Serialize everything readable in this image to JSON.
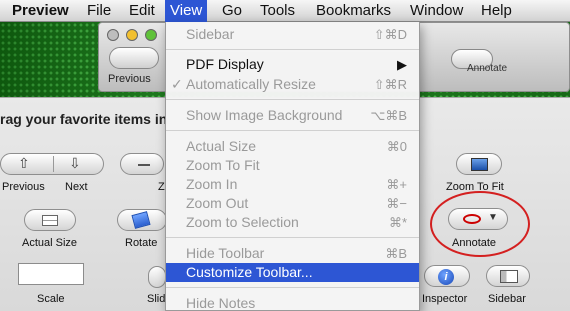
{
  "menubar": {
    "apple_menu": "Preview",
    "items": [
      "File",
      "Edit",
      "View",
      "Go",
      "Tools",
      "Bookmarks",
      "Window",
      "Help"
    ]
  },
  "background_window": {
    "previous_label": "Previous",
    "annotate_label": "Annotate"
  },
  "view_menu": {
    "items": [
      {
        "label": "Sidebar",
        "shortcut": "⇧⌘D",
        "enabled": false
      },
      {
        "label": "PDF Display",
        "shortcut": "▶",
        "enabled": true
      },
      {
        "label": "Automatically Resize",
        "shortcut": "⇧⌘R",
        "enabled": false,
        "checked": true,
        "check": "✓"
      },
      {
        "label": "Show Image Background",
        "shortcut": "⌥⌘B",
        "enabled": false
      },
      {
        "label": "Actual Size",
        "shortcut": "⌘0",
        "enabled": false
      },
      {
        "label": "Zoom To Fit",
        "shortcut": "",
        "enabled": false
      },
      {
        "label": "Zoom In",
        "shortcut": "⌘+",
        "enabled": false
      },
      {
        "label": "Zoom Out",
        "shortcut": "⌘−",
        "enabled": false
      },
      {
        "label": "Zoom to Selection",
        "shortcut": "⌘*",
        "enabled": false
      },
      {
        "label": "Hide Toolbar",
        "shortcut": "⌘B",
        "enabled": false
      },
      {
        "label": "Customize Toolbar...",
        "shortcut": "",
        "enabled": true,
        "highlighted": true
      },
      {
        "label": "Hide Notes",
        "shortcut": "",
        "enabled": false
      }
    ]
  },
  "customize_sheet": {
    "heading": "rag your favorite items in",
    "items": {
      "previous": "Previous",
      "next": "Next",
      "zoom": "Z",
      "zoom_to_fit": "Zoom To Fit",
      "actual_size": "Actual Size",
      "rotate": "Rotate",
      "annotate": "Annotate",
      "scale": "Scale",
      "slideshow": "Slid",
      "inspector": "Inspector",
      "sidebar": "Sidebar"
    },
    "info_glyph": "i",
    "annotate_chevron": "▼"
  },
  "annotation_color": "#d42020",
  "accent_color": "#2d56d4"
}
